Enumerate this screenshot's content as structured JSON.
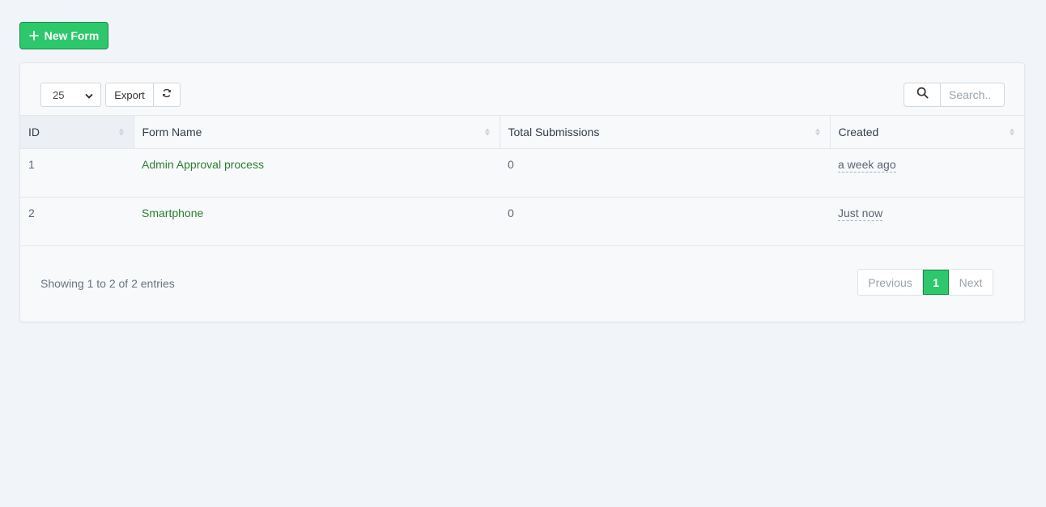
{
  "toolbar": {
    "new_form_label": "New Form",
    "page_size": "25",
    "export_label": "Export",
    "search_placeholder": "Search.."
  },
  "table": {
    "columns": [
      "ID",
      "Form Name",
      "Total Submissions",
      "Created"
    ],
    "rows": [
      {
        "id": "1",
        "name": "Admin Approval process",
        "submissions": "0",
        "created": "a week ago"
      },
      {
        "id": "2",
        "name": "Smartphone",
        "submissions": "0",
        "created": "Just now"
      }
    ]
  },
  "footer": {
    "info": "Showing 1 to 2 of 2 entries",
    "previous_label": "Previous",
    "current_page": "1",
    "next_label": "Next"
  },
  "colors": {
    "accent": "#2dc86c",
    "link": "#2e7d32",
    "background": "#f1f4f8"
  }
}
